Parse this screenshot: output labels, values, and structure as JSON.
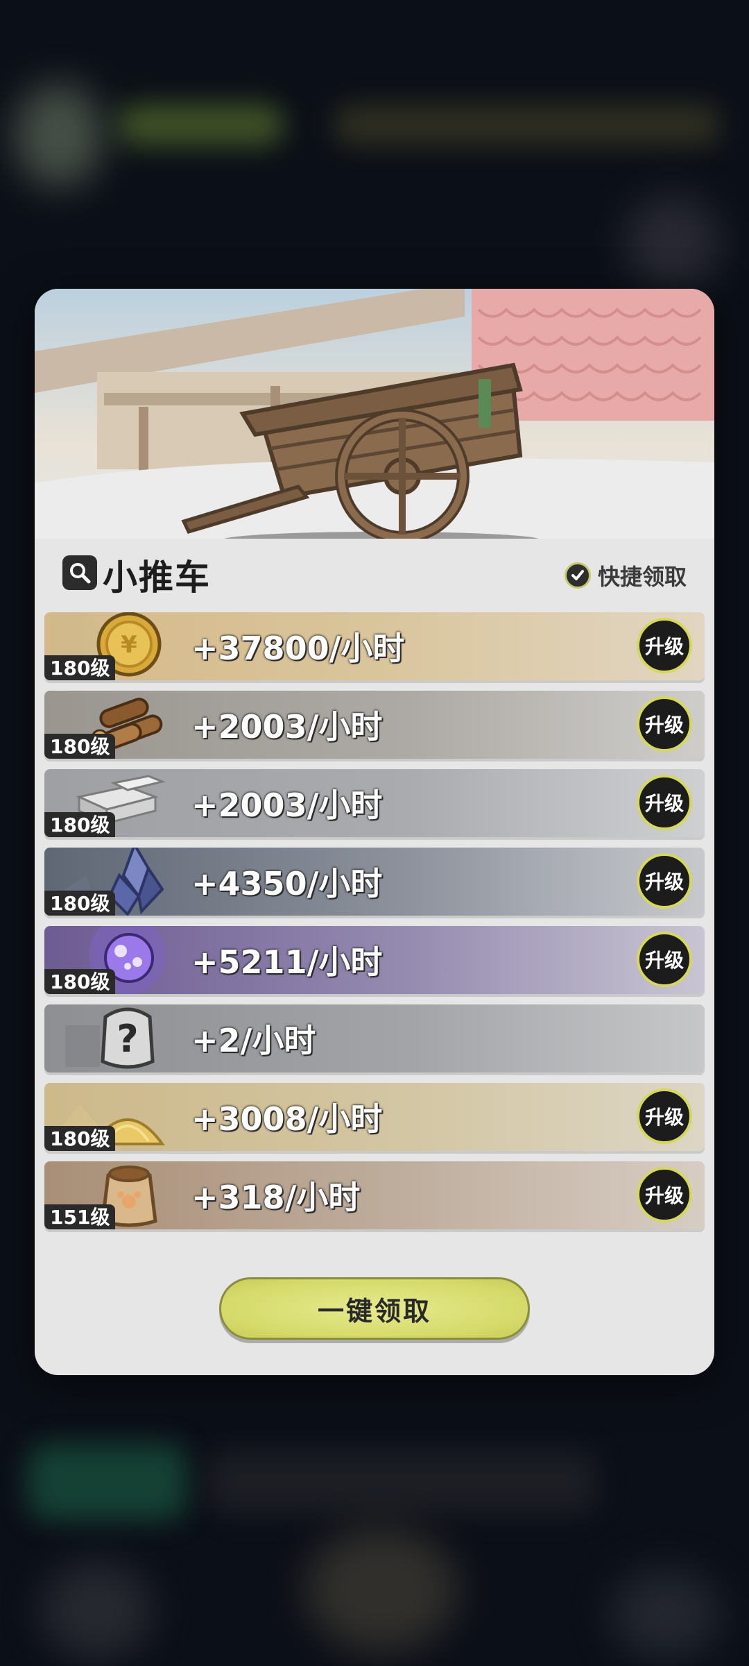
{
  "panel": {
    "title": "小推车",
    "quick_claim_label": "快捷领取",
    "claim_all_label": "一键领取"
  },
  "resources": [
    {
      "id": "gold",
      "level": "180级",
      "rate": "+37800/小时",
      "upgrade_label": "升级"
    },
    {
      "id": "wood",
      "level": "180级",
      "rate": "+2003/小时",
      "upgrade_label": "升级"
    },
    {
      "id": "stone",
      "level": "180级",
      "rate": "+2003/小时",
      "upgrade_label": "升级"
    },
    {
      "id": "crystal",
      "level": "180级",
      "rate": "+4350/小时",
      "upgrade_label": "升级"
    },
    {
      "id": "purple-orb",
      "level": "180级",
      "rate": "+5211/小时",
      "upgrade_label": "升级"
    },
    {
      "id": "unknown",
      "level": "",
      "rate": "+2/小时",
      "upgrade_label": ""
    },
    {
      "id": "sand",
      "level": "180级",
      "rate": "+3008/小时",
      "upgrade_label": "升级"
    },
    {
      "id": "sack",
      "level": "151级",
      "rate": "+318/小时",
      "upgrade_label": "升级"
    }
  ],
  "colors": {
    "accent": "#d6d85c",
    "button": "#dfe27a",
    "modal": "#e6e6e6"
  }
}
